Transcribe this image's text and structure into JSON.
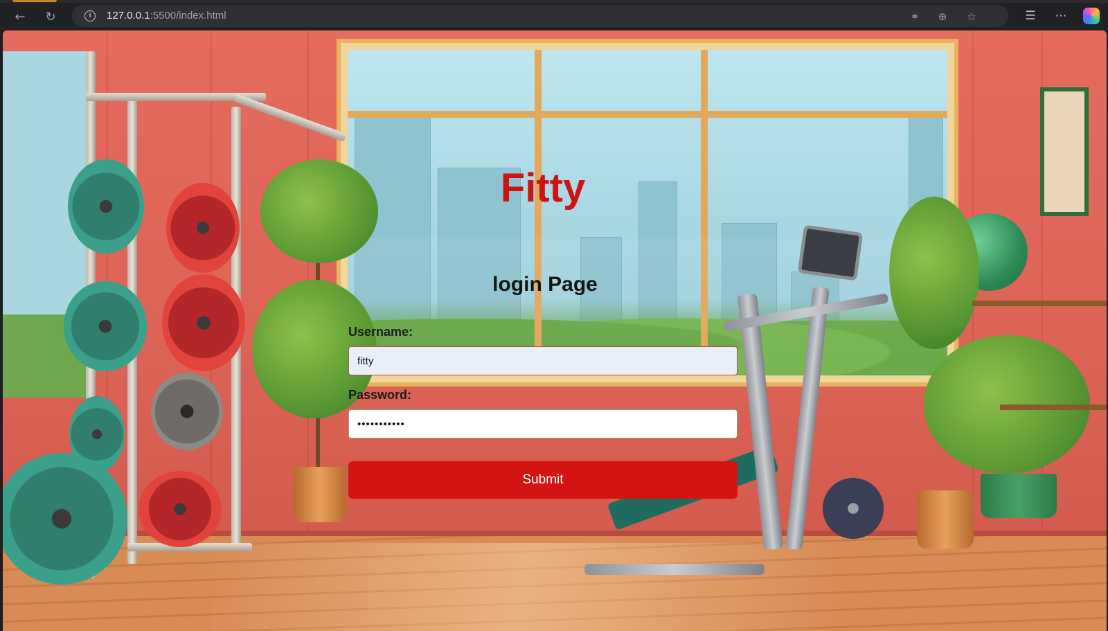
{
  "browser": {
    "url_host": "127.0.0.1",
    "url_rest": ":5500/index.html",
    "icons": {
      "back": "back-arrow-icon",
      "reload": "reload-icon",
      "site_info": "info-icon",
      "key": "key-icon",
      "zoom": "zoom-icon",
      "favorite": "star-icon",
      "favorites": "favorites-icon",
      "more": "more-icon",
      "copilot": "copilot-icon"
    }
  },
  "page": {
    "app_title": "Fitty",
    "heading": "login Page",
    "username_label": "Username:",
    "username_value": "fitty",
    "password_label": "Password:",
    "password_value": "•••••••••••",
    "submit_label": "Submit"
  },
  "colors": {
    "brand_red": "#cc1414",
    "button_red": "#d41313",
    "autofill_bg": "#e8eefa"
  }
}
